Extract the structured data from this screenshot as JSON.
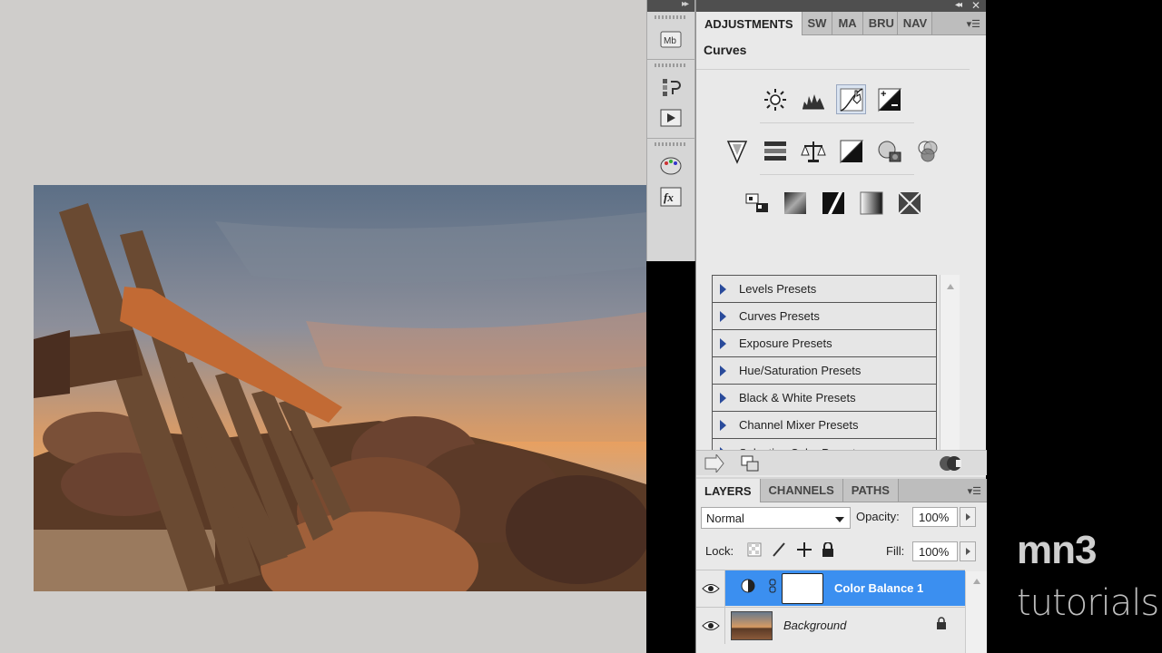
{
  "adjustments_panel": {
    "tabs": [
      {
        "label": "ADJUSTMENTS",
        "active": true
      },
      {
        "label": "SW",
        "active": false
      },
      {
        "label": "MA",
        "active": false
      },
      {
        "label": "BRU",
        "active": false
      },
      {
        "label": "NAV",
        "active": false
      }
    ],
    "title": "Curves",
    "icon_rows": [
      [
        "brightness-contrast-icon",
        "levels-icon",
        "curves-icon",
        "exposure-icon"
      ],
      [
        "vibrance-icon",
        "hue-saturation-icon",
        "color-balance-icon",
        "black-white-icon",
        "photo-filter-icon",
        "channel-mixer-icon"
      ],
      [
        "invert-icon",
        "posterize-icon",
        "threshold-icon",
        "gradient-map-icon",
        "selective-color-icon"
      ]
    ],
    "presets": [
      "Levels Presets",
      "Curves Presets",
      "Exposure Presets",
      "Hue/Saturation Presets",
      "Black & White Presets",
      "Channel Mixer Presets",
      "Selective Color Presets"
    ]
  },
  "layers_panel": {
    "tabs": [
      {
        "label": "LAYERS",
        "active": true
      },
      {
        "label": "CHANNELS",
        "active": false
      },
      {
        "label": "PATHS",
        "active": false
      }
    ],
    "blend_mode": "Normal",
    "opacity_label": "Opacity:",
    "opacity_value": "100%",
    "lock_label": "Lock:",
    "fill_label": "Fill:",
    "fill_value": "100%",
    "layers": [
      {
        "name": "Color Balance 1",
        "selected": true,
        "italic": false
      },
      {
        "name": "Background",
        "selected": false,
        "italic": true
      }
    ]
  },
  "brand": {
    "logo": "mn3",
    "tagline": "tutorials"
  },
  "colors": {
    "selection": "#3b8ff0",
    "preset_triangle": "#2a4b9b",
    "canvas_bg": "#cfcdcb"
  }
}
